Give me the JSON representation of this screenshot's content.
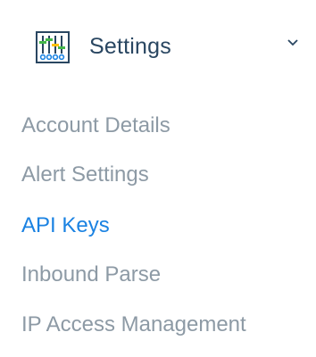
{
  "section": {
    "title": "Settings",
    "icon": "settings-sliders-icon",
    "expanded": true
  },
  "nav": {
    "items": [
      {
        "label": "Account Details",
        "active": false
      },
      {
        "label": "Alert Settings",
        "active": false
      },
      {
        "label": "API Keys",
        "active": true
      },
      {
        "label": "Inbound Parse",
        "active": false
      },
      {
        "label": "IP Access Management",
        "active": false
      }
    ]
  },
  "colors": {
    "title": "#294661",
    "item": "#8d9aa5",
    "active": "#1a82e2",
    "icon_green": "#43b649",
    "icon_blue": "#1a82e2",
    "icon_yellow": "#ffc107"
  }
}
